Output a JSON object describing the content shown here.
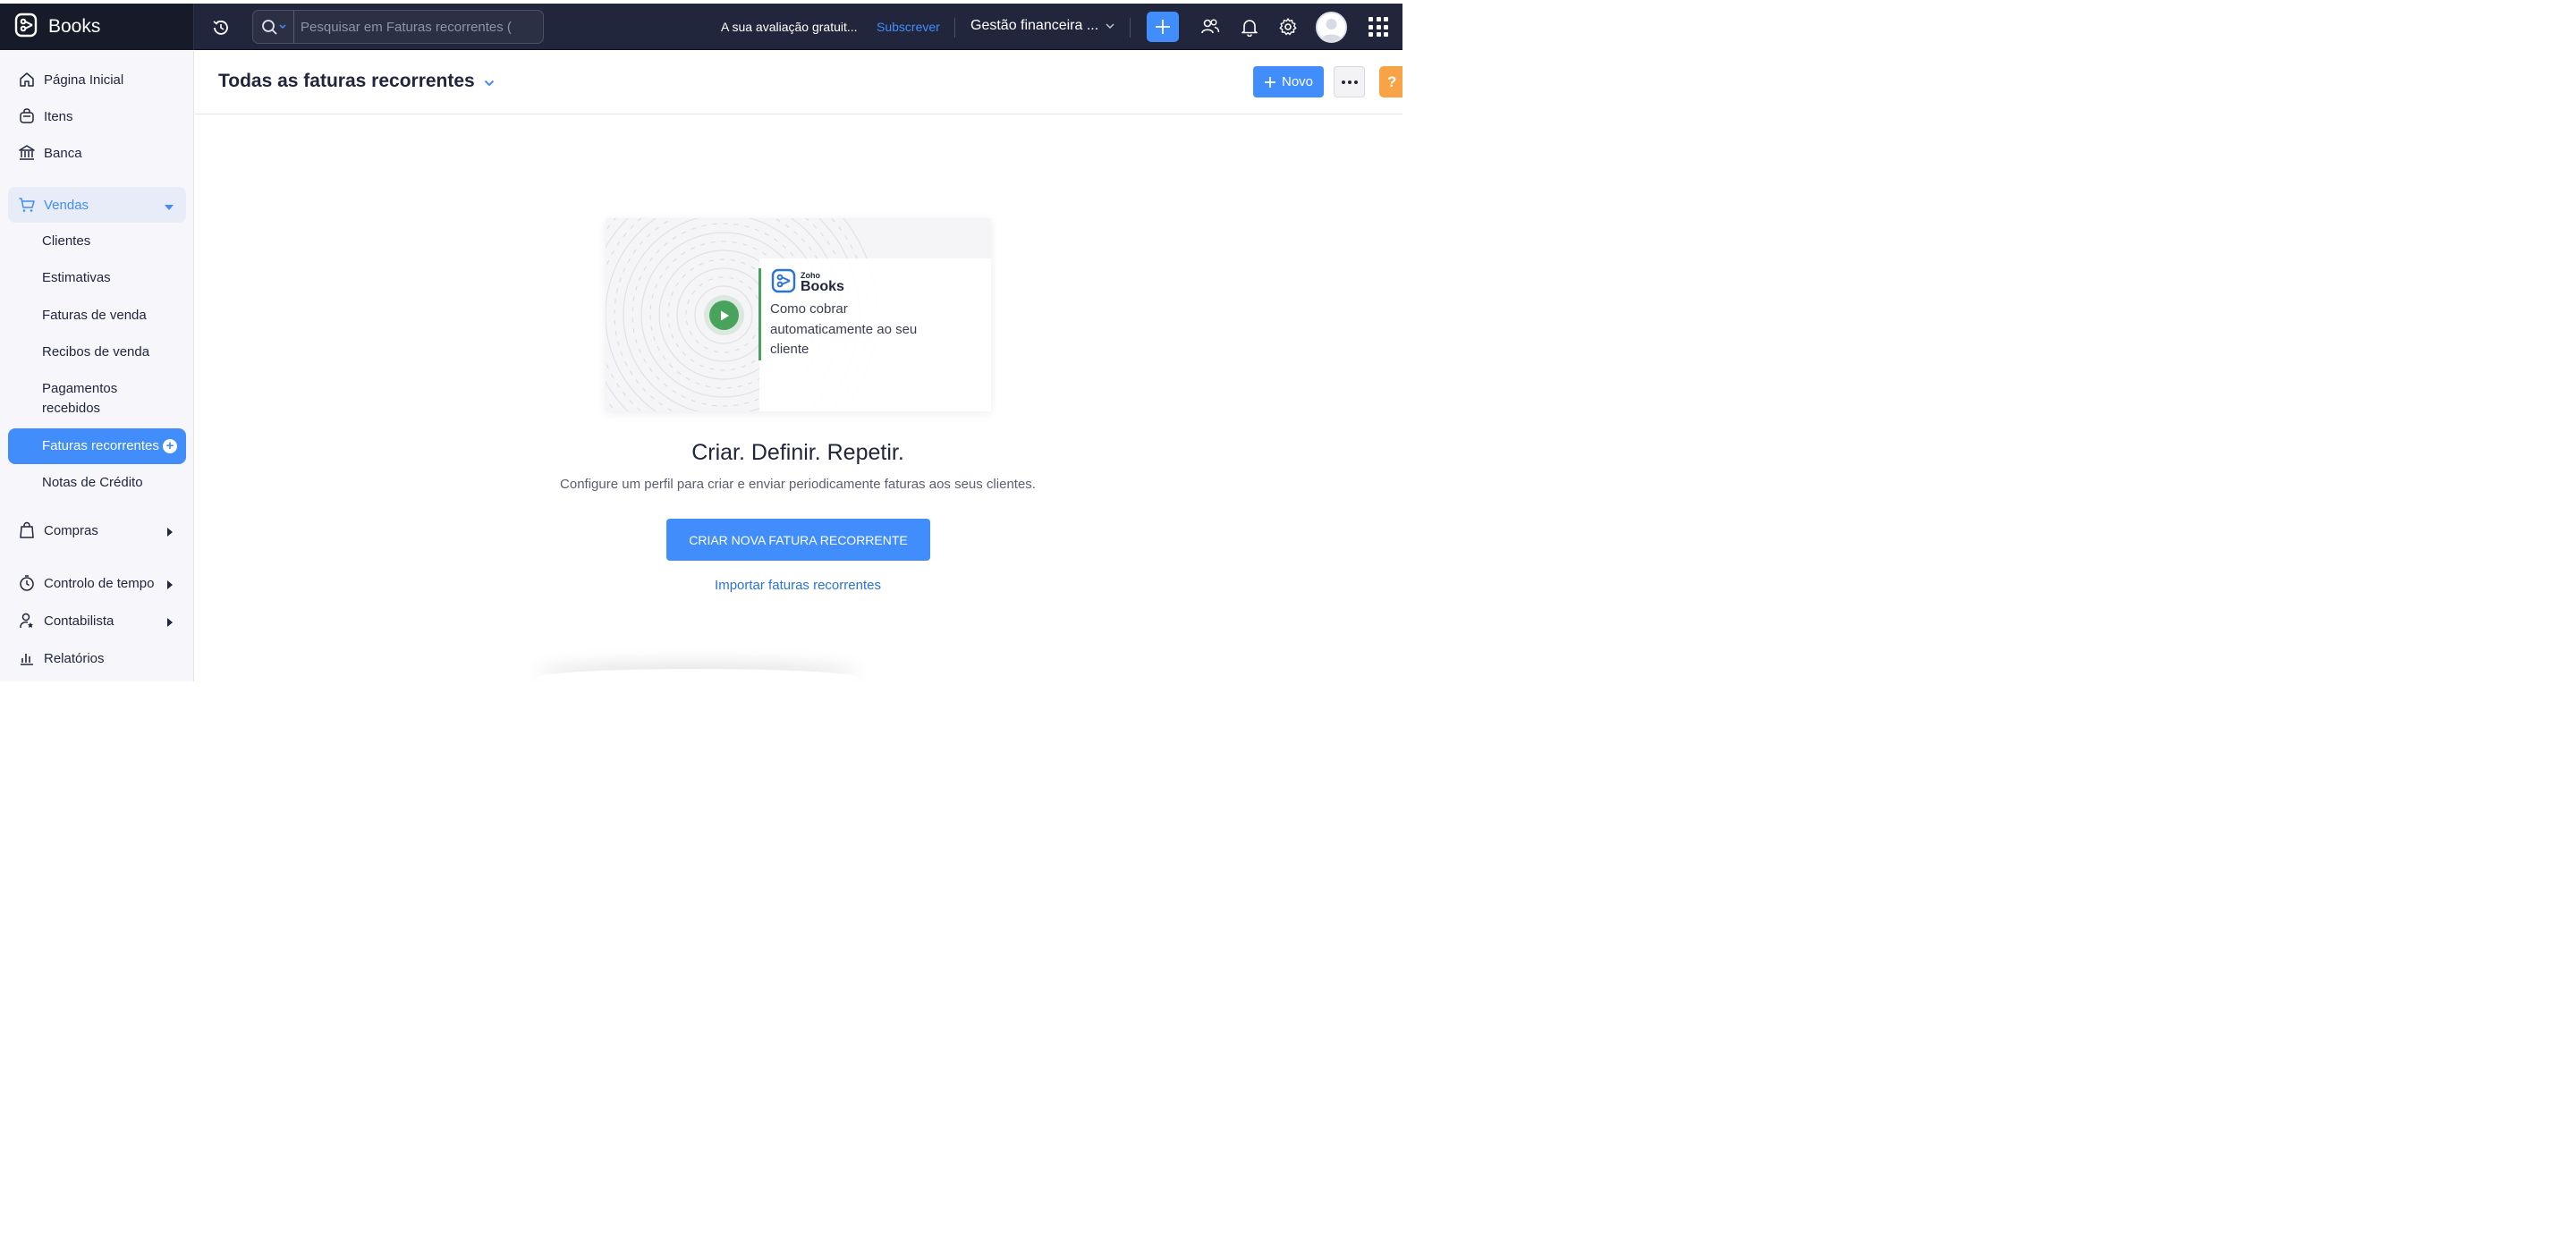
{
  "app": {
    "name": "Books"
  },
  "topbar": {
    "search_placeholder": "Pesquisar em Faturas recorrentes (",
    "trial_text": "A sua avaliação gratuit...",
    "subscribe_label": "Subscrever",
    "org_name": "Gestão financeira ...",
    "accent_color": "#408dfb",
    "bar_color": "#21263c"
  },
  "sidebar": {
    "items": [
      {
        "label": "Página Inicial",
        "icon": "home-icon"
      },
      {
        "label": "Itens",
        "icon": "items-bag-icon"
      },
      {
        "label": "Banca",
        "icon": "bank-icon"
      },
      {
        "label": "Vendas",
        "icon": "cart-icon"
      },
      {
        "label": "Compras",
        "icon": "shopping-bag-icon"
      },
      {
        "label": "Controlo de tempo",
        "icon": "stopwatch-icon"
      },
      {
        "label": "Contabilista",
        "icon": "accountant-icon"
      },
      {
        "label": "Relatórios",
        "icon": "bar-chart-icon"
      }
    ],
    "vendas_subitems": [
      {
        "label": "Clientes"
      },
      {
        "label": "Estimativas"
      },
      {
        "label": "Faturas de venda"
      },
      {
        "label": "Recibos de venda"
      },
      {
        "label": "Pagamentos recebidos"
      },
      {
        "label": "Faturas recorrentes"
      },
      {
        "label": "Notas de Crédito"
      }
    ]
  },
  "header": {
    "title": "Todas as faturas recorrentes",
    "new_label": "Novo",
    "help_label": "?"
  },
  "empty_state": {
    "video_brand_small": "Zoho",
    "video_brand_big": "Books",
    "video_caption": "Como cobrar automaticamente ao seu cliente",
    "title": "Criar. Definir. Repetir.",
    "description": "Configure um perfil para criar e enviar periodicamente faturas aos seus clientes.",
    "create_label": "CRIAR NOVA FATURA RECORRENTE",
    "import_label": "Importar faturas recorrentes"
  }
}
